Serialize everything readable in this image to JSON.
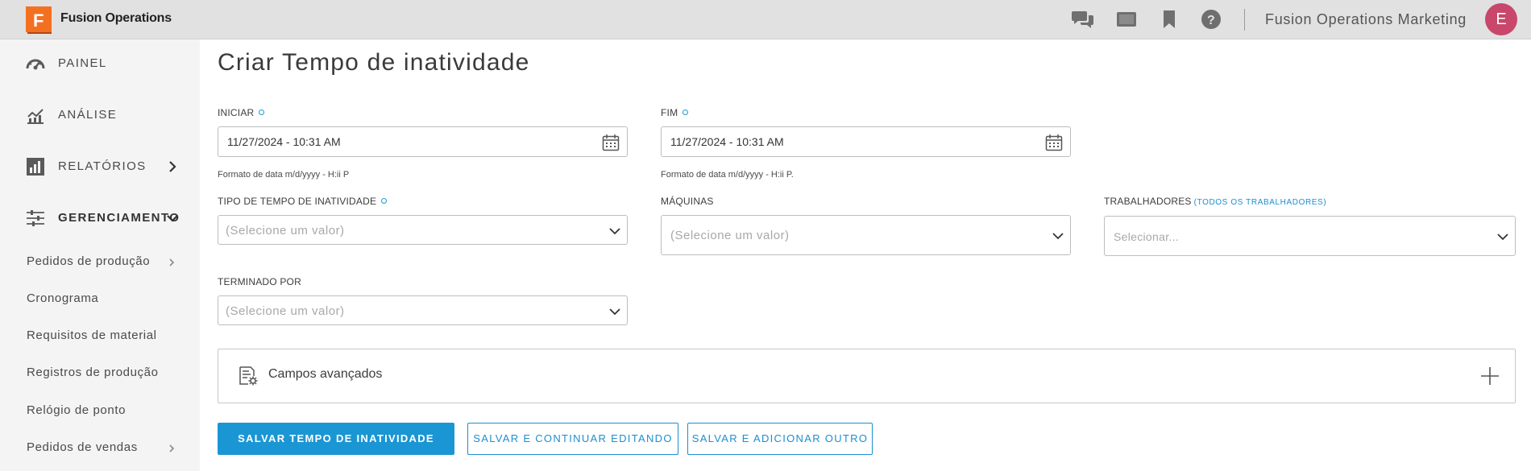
{
  "app": {
    "name": "Fusion Operations",
    "logo_letter": "F",
    "brand_color": "#f37021"
  },
  "topbar": {
    "icons": [
      "chat-icon",
      "tablet-icon",
      "bookmark-icon",
      "help-icon"
    ],
    "org_name": "Fusion Operations Marketing",
    "avatar_letter": "E",
    "avatar_color": "#c8476b"
  },
  "sidebar": {
    "items": [
      {
        "label": "PAINEL",
        "icon": "dashboard-icon"
      },
      {
        "label": "ANÁLISE",
        "icon": "analytics-icon"
      },
      {
        "label": "RELATÓRIOS",
        "icon": "reports-icon"
      },
      {
        "label": "GERENCIAMENTO",
        "icon": "management-icon"
      }
    ],
    "sub_items": [
      {
        "label": "Pedidos de produção"
      },
      {
        "label": "Cronograma"
      },
      {
        "label": "Requisitos de material"
      },
      {
        "label": "Registros de produção"
      },
      {
        "label": "Relógio de ponto"
      },
      {
        "label": "Pedidos de vendas"
      }
    ]
  },
  "main": {
    "title": "Criar Tempo de inatividade",
    "start": {
      "label": "INICIAR",
      "value": "11/27/2024 - 10:31 AM",
      "hint": "Formato de data m/d/yyyy - H:ii P"
    },
    "end": {
      "label": "FIM",
      "value": "11/27/2024 - 10:31 AM",
      "hint": "Formato de data m/d/yyyy - H:ii P."
    },
    "downtime_type": {
      "label": "TIPO DE TEMPO DE INATIVIDADE",
      "placeholder": "(Selecione um valor)"
    },
    "machines": {
      "label": "MÁQUINAS",
      "placeholder": "(Selecione um valor)"
    },
    "workers": {
      "label": "TRABALHADORES",
      "link": "(TODOS OS TRABALHADORES)",
      "placeholder": "Selecionar..."
    },
    "ended_by": {
      "label": "TERMINADO POR",
      "placeholder": "(Selecione um valor)"
    },
    "advanced": {
      "label": "Campos avançados"
    },
    "buttons": {
      "save": "SALVAR TEMPO DE INATIVIDADE",
      "save_continue": "SALVAR E CONTINUAR EDITANDO",
      "save_add": "SALVAR E ADICIONAR OUTRO"
    }
  },
  "colors": {
    "accent": "#1a96d4",
    "required_dot": "#1b9ad6"
  }
}
